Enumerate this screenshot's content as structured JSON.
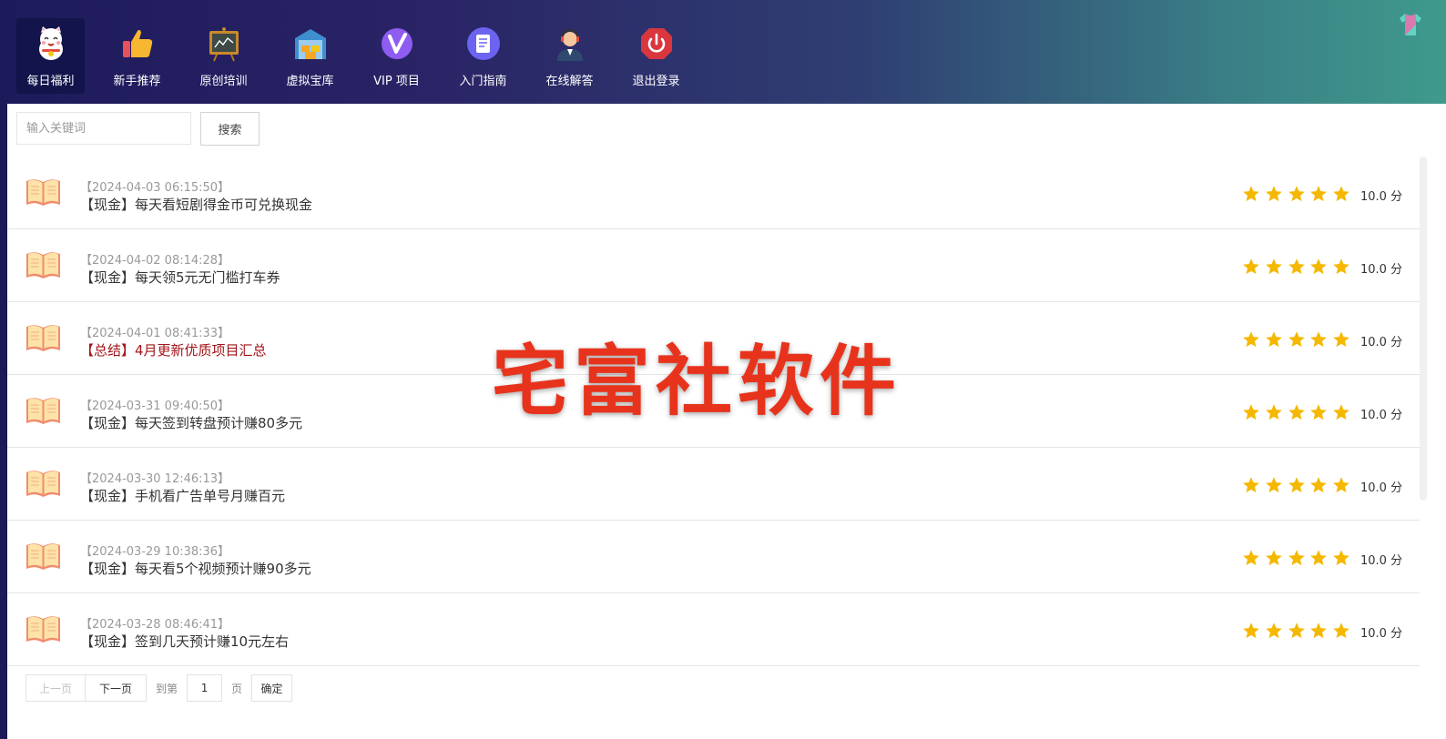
{
  "nav": {
    "items": [
      {
        "label": "每日福利",
        "icon": "lucky-cat-icon",
        "active": true
      },
      {
        "label": "新手推荐",
        "icon": "thumbs-up-icon",
        "active": false
      },
      {
        "label": "原创培训",
        "icon": "chalkboard-icon",
        "active": false
      },
      {
        "label": "虚拟宝库",
        "icon": "warehouse-icon",
        "active": false
      },
      {
        "label": "VIP 项目",
        "icon": "vip-icon",
        "active": false
      },
      {
        "label": "入门指南",
        "icon": "document-icon",
        "active": false
      },
      {
        "label": "在线解答",
        "icon": "support-agent-icon",
        "active": false
      },
      {
        "label": "退出登录",
        "icon": "power-icon",
        "active": false
      }
    ]
  },
  "search": {
    "placeholder": "输入关键词",
    "value": "",
    "button_label": "搜索"
  },
  "list": {
    "items": [
      {
        "date": "【2024-04-03 06:15:50】",
        "title": "【现金】每天看短剧得金币可兑换现金",
        "type": "cash",
        "rating": 5,
        "score": "10.0 分"
      },
      {
        "date": "【2024-04-02 08:14:28】",
        "title": "【现金】每天领5元无门槛打车券",
        "type": "cash",
        "rating": 5,
        "score": "10.0 分"
      },
      {
        "date": "【2024-04-01 08:41:33】",
        "title": "【总结】4月更新优质项目汇总",
        "type": "summary",
        "rating": 5,
        "score": "10.0 分"
      },
      {
        "date": "【2024-03-31 09:40:50】",
        "title": "【现金】每天签到转盘预计赚80多元",
        "type": "cash",
        "rating": 5,
        "score": "10.0 分"
      },
      {
        "date": "【2024-03-30 12:46:13】",
        "title": "【现金】手机看广告单号月赚百元",
        "type": "cash",
        "rating": 5,
        "score": "10.0 分"
      },
      {
        "date": "【2024-03-29 10:38:36】",
        "title": "【现金】每天看5个视频预计赚90多元",
        "type": "cash",
        "rating": 5,
        "score": "10.0 分"
      },
      {
        "date": "【2024-03-28 08:46:41】",
        "title": "【现金】签到几天预计赚10元左右",
        "type": "cash",
        "rating": 5,
        "score": "10.0 分"
      }
    ]
  },
  "pagination": {
    "prev_label": "上一页",
    "next_label": "下一页",
    "goto_label": "到第",
    "page_value": "1",
    "page_unit": "页",
    "confirm_label": "确定"
  },
  "watermark": "宅富社软件",
  "colors": {
    "star": "#f5b800",
    "summary_title": "#a3141a",
    "watermark": "#e8331c"
  }
}
